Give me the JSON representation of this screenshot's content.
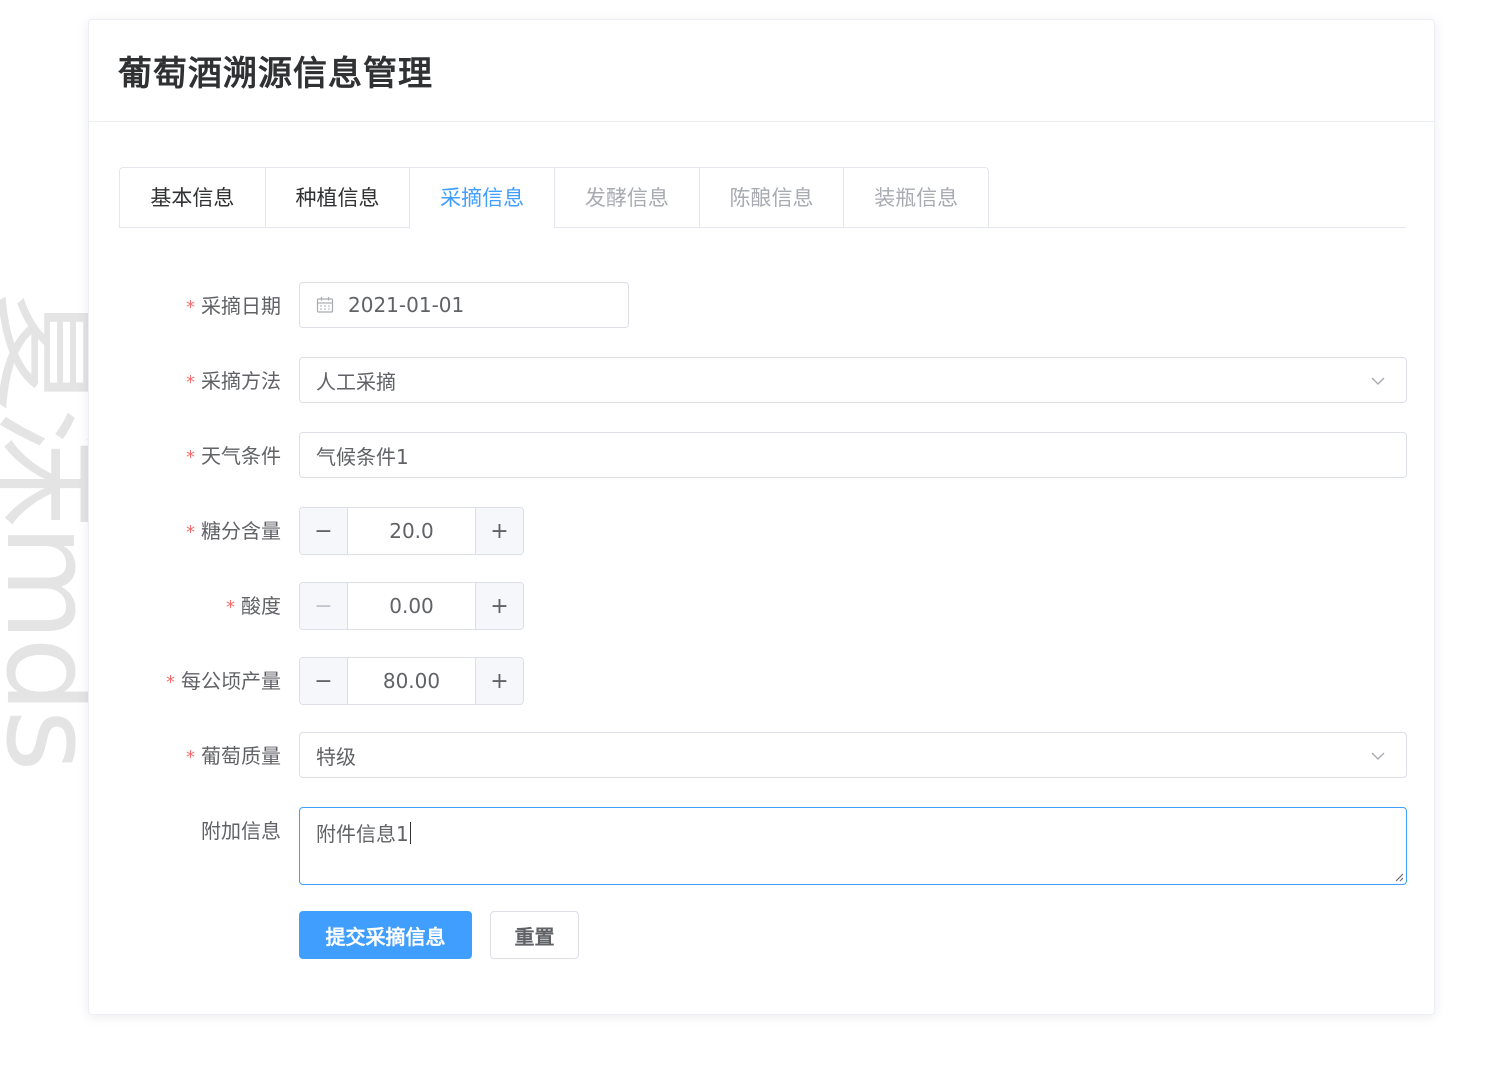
{
  "watermark": "夏沫mds",
  "card": {
    "title": "葡萄酒溯源信息管理"
  },
  "tabs": [
    {
      "label": "基本信息",
      "state": "done"
    },
    {
      "label": "种植信息",
      "state": "done"
    },
    {
      "label": "采摘信息",
      "state": "active"
    },
    {
      "label": "发酵信息",
      "state": "pending"
    },
    {
      "label": "陈酿信息",
      "state": "pending"
    },
    {
      "label": "装瓶信息",
      "state": "pending"
    }
  ],
  "form": {
    "required_mark": "*",
    "harvest_date": {
      "label": "采摘日期",
      "value": "2021-01-01",
      "icon": "calendar-icon"
    },
    "harvest_method": {
      "label": "采摘方法",
      "value": "人工采摘",
      "icon": "chevron-down-icon"
    },
    "weather": {
      "label": "天气条件",
      "value": "气候条件1"
    },
    "sugar": {
      "label": "糖分含量",
      "value": "20.0",
      "minus": "−",
      "plus": "+"
    },
    "acidity": {
      "label": "酸度",
      "value": "0.00",
      "minus": "−",
      "plus": "+"
    },
    "yield": {
      "label": "每公顷产量",
      "value": "80.00",
      "minus": "−",
      "plus": "+"
    },
    "quality": {
      "label": "葡萄质量",
      "value": "特级",
      "icon": "chevron-down-icon"
    },
    "extra": {
      "label": "附加信息",
      "value": "附件信息1"
    }
  },
  "actions": {
    "submit_label": "提交采摘信息",
    "reset_label": "重置"
  },
  "colors": {
    "primary": "#409eff",
    "required": "#f56c6c",
    "text": "#606266",
    "title": "#303133"
  }
}
